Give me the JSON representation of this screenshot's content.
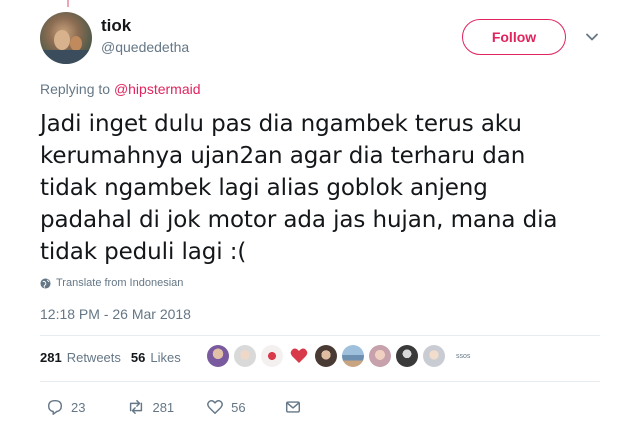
{
  "author": {
    "display_name": "tiok",
    "handle": "@quededetha"
  },
  "follow_label": "Follow",
  "replying": {
    "prefix": "Replying to",
    "mention": "@hipstermaid"
  },
  "tweet": {
    "text_lines": [
      "Jadi inget dulu pas dia ngambek terus aku",
      "kerumahnya ujan2an agar dia terharu dan",
      "tidak ngambek lagi alias goblok anjeng",
      "padahal di jok motor ada jas hujan, mana dia",
      "tidak peduli lagi :("
    ],
    "translate_label": "Translate from Indonesian",
    "timestamp": "12:18 PM - 26 Mar 2018"
  },
  "stats": {
    "retweets_count": "281",
    "retweets_label": "Retweets",
    "likes_count": "56",
    "likes_label": "Likes"
  },
  "likers": [
    {
      "name": "liker-1",
      "color": "#7a5a9e"
    },
    {
      "name": "liker-2",
      "color": "#d9d9d9"
    },
    {
      "name": "liker-3",
      "color": "#f5f0f0"
    },
    {
      "name": "liker-4",
      "color": "#d93a4a"
    },
    {
      "name": "liker-5",
      "color": "#4a3a34"
    },
    {
      "name": "liker-6",
      "color": "#6d8fb0"
    },
    {
      "name": "liker-7",
      "color": "#c7a1ab"
    },
    {
      "name": "liker-8",
      "color": "#3a3a3a"
    },
    {
      "name": "liker-9",
      "color": "#c9ccd2"
    }
  ],
  "likers_extra_label": "ssos",
  "actions": {
    "replies": "23",
    "retweets": "281",
    "likes": "56"
  },
  "colors": {
    "accent": "#e0245e",
    "muted": "#657786",
    "text": "#14171a"
  },
  "icons": [
    "chevron-down-icon",
    "globe-icon",
    "reply-icon",
    "retweet-icon",
    "heart-icon",
    "message-icon"
  ]
}
